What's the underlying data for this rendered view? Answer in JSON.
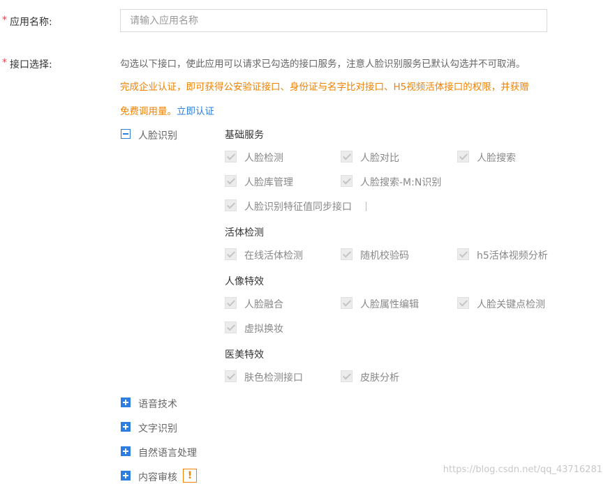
{
  "form": {
    "required_mark": "*",
    "app_name_label": "应用名称:",
    "app_name_placeholder": "请输入应用名称",
    "app_name_value": "",
    "api_select_label": "接口选择:",
    "description": "勾选以下接口，使此应用可以请求已勾选的接口服务，注意人脸识别服务已默认勾选并不可取消。",
    "notice_line1": "完成企业认证，即可获得公安验证接口、身份证与名字比对接口、H5视频活体接口的权限，并获赠",
    "notice_line2": "免费调用量。",
    "notice_link": "立即认证"
  },
  "categories": [
    {
      "label": "人脸识别",
      "expanded": true,
      "groups": [
        {
          "title": "基础服务",
          "items": [
            "人脸检测",
            "人脸对比",
            "人脸搜索",
            "人脸库管理",
            "人脸搜索-M:N识别",
            "人脸识别特征值同步接口"
          ]
        },
        {
          "title": "活体检测",
          "items": [
            "在线活体检测",
            "随机校验码",
            "h5活体视频分析"
          ]
        },
        {
          "title": "人像特效",
          "items": [
            "人脸融合",
            "人脸属性编辑",
            "人脸关键点检测",
            "虚拟换妆"
          ]
        },
        {
          "title": "医美特效",
          "items": [
            "肤色检测接口",
            "皮肤分析"
          ]
        }
      ]
    },
    {
      "label": "语音技术",
      "expanded": false
    },
    {
      "label": "文字识别",
      "expanded": false
    },
    {
      "label": "自然语言处理",
      "expanded": false
    },
    {
      "label": "内容审核",
      "expanded": false,
      "badge": "!"
    }
  ],
  "watermark": "https://blog.csdn.net/qq_43716281",
  "colors": {
    "required": "#e64552",
    "notice": "#f08200",
    "link": "#2c7fe0",
    "checkbox_disabled": "#ececec"
  },
  "icons": {
    "collapse": "minus-square-icon",
    "expand": "plus-square-icon",
    "checked": "checkmark-icon",
    "warning": "exclamation-icon"
  }
}
